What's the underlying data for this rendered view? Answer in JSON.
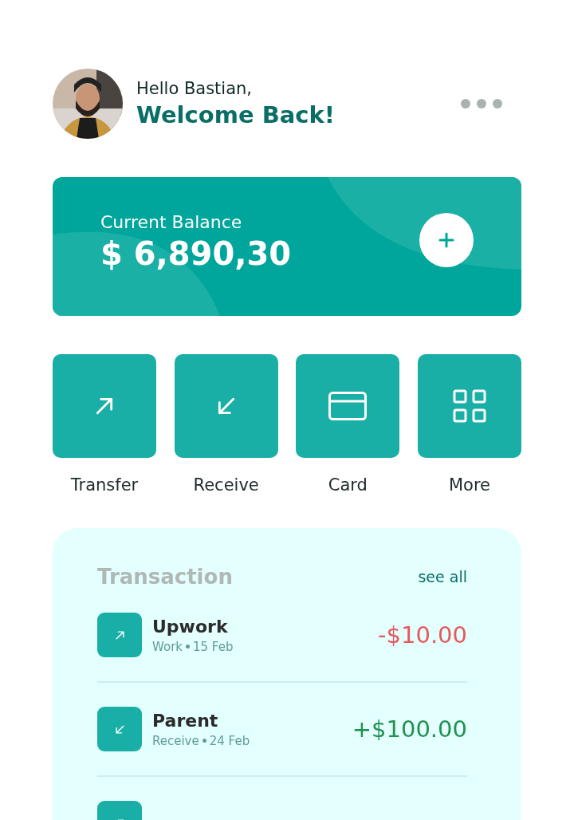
{
  "greeting": {
    "hello": "Hello Bastian,",
    "welcome": "Welcome Back!"
  },
  "balance": {
    "label": "Current Balance",
    "amount": "$ 6,890,30"
  },
  "actions": [
    {
      "kind": "transfer",
      "label": "Transfer"
    },
    {
      "kind": "receive",
      "label": "Receive"
    },
    {
      "kind": "card",
      "label": "Card"
    },
    {
      "kind": "more",
      "label": "More"
    }
  ],
  "transactions": {
    "title": "Transaction",
    "see_all": "see all",
    "items": [
      {
        "kind": "out",
        "name": "Upwork",
        "category": "Work",
        "date": "15 Feb",
        "amount": "-$10.00"
      },
      {
        "kind": "in",
        "name": "Parent",
        "category": "Receive",
        "date": "24 Feb",
        "amount": "+$100.00"
      },
      {
        "kind": "out"
      }
    ]
  }
}
